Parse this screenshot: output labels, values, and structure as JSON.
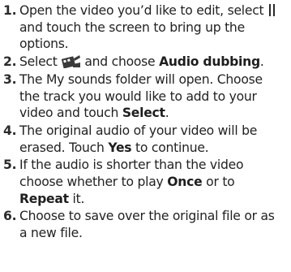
{
  "steps": [
    {
      "number": "1.",
      "t1": "Open the video you’d like to edit, select",
      "icon": "pause-icon",
      "t2": "and touch the screen to bring up the options."
    },
    {
      "number": "2.",
      "t1": "Select",
      "icon": "video-edit-icon",
      "t2": "and choose",
      "b1": "Audio dubbing",
      "t3": "."
    },
    {
      "number": "3.",
      "t1": "The My sounds folder will open. Choose the track you would like to add to your video and touch",
      "b1": "Select",
      "t2": "."
    },
    {
      "number": "4.",
      "t1": "The original audio of your video will be erased. Touch",
      "b1": "Yes",
      "t2": "to continue."
    },
    {
      "number": "5.",
      "t1": "If the audio is shorter than the video choose whether to play",
      "b1": "Once",
      "t2": "or to",
      "b2": "Repeat",
      "t3": "it."
    },
    {
      "number": "6.",
      "t1": "Choose to save over the original file or as a new file."
    }
  ]
}
